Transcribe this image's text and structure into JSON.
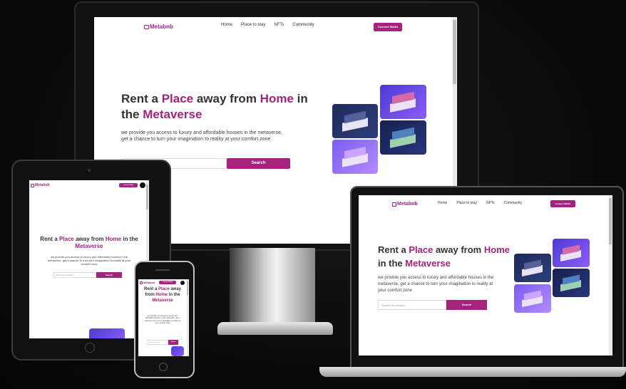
{
  "site": {
    "logo": "Metabnb",
    "nav": [
      "Home",
      "Place to stay",
      "NFTs",
      "Community"
    ],
    "connect_button": "Connect Wallet",
    "hero": {
      "t1": "Rent a ",
      "t2": "Place",
      "t3": " away from ",
      "t4": "Home",
      "t5": " in the ",
      "t6": "Metaverse",
      "desc": "we provide you access to luxury and affordable houses in the metaverse, get a chance to turn your imagination to reality at your comfort zone"
    },
    "search": {
      "placeholder": "Search for location",
      "button": "Search"
    }
  },
  "colors": {
    "accent": "#a3237d",
    "background": "#0b0b0b"
  },
  "icons": {
    "logo": "house-icon",
    "menu": "hamburger-icon"
  }
}
